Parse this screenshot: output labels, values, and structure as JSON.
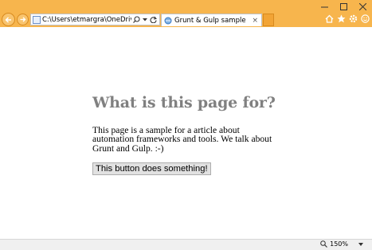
{
  "browser": {
    "address": "C:\\Users\\etmargra\\OneDrive\\Mic",
    "tab_title": "Grunt & Gulp sample",
    "tab_close": "×",
    "zoom": "150%",
    "chrome_color": "#f7b54d"
  },
  "page": {
    "heading": "What is this page for?",
    "paragraph": "This page is a sample for a article about automation frameworks and tools. We talk about Grunt and Gulp. :-)",
    "button_label": "This button does something!"
  },
  "icons": {
    "back": "back-arrow-icon",
    "forward": "forward-arrow-icon",
    "search": "search-icon",
    "refresh": "refresh-icon",
    "home": "home-icon",
    "favorites": "star-icon",
    "settings": "gear-icon",
    "feedback": "smiley-icon",
    "zoom": "magnifier-icon"
  }
}
